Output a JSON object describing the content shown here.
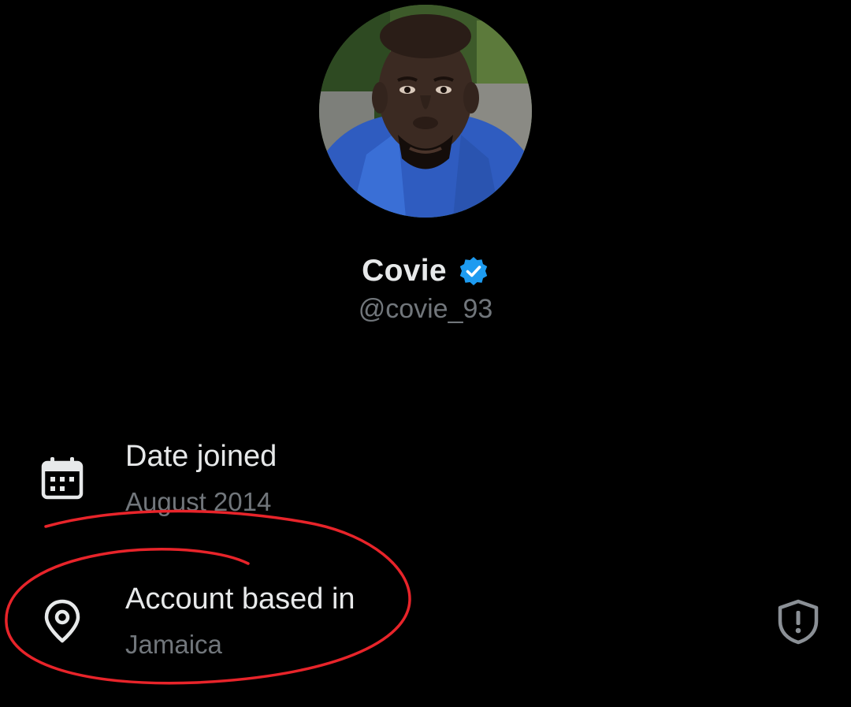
{
  "profile": {
    "display_name": "Covie",
    "handle": "@covie_93",
    "verified": true,
    "avatar_description_icon": "avatar-photo"
  },
  "about": {
    "rows": [
      {
        "icon": "calendar-icon",
        "title": "Date joined",
        "value": "August 2014"
      },
      {
        "icon": "location-pin-icon",
        "title": "Account based in",
        "value": "Jamaica",
        "trailing_icon": "shield-alert-icon"
      }
    ]
  },
  "colors": {
    "background": "#000000",
    "primary_text": "#e7e9ea",
    "secondary_text": "#71767b",
    "verified_blue": "#1d9bf0",
    "annotation_red": "#e8242a"
  }
}
